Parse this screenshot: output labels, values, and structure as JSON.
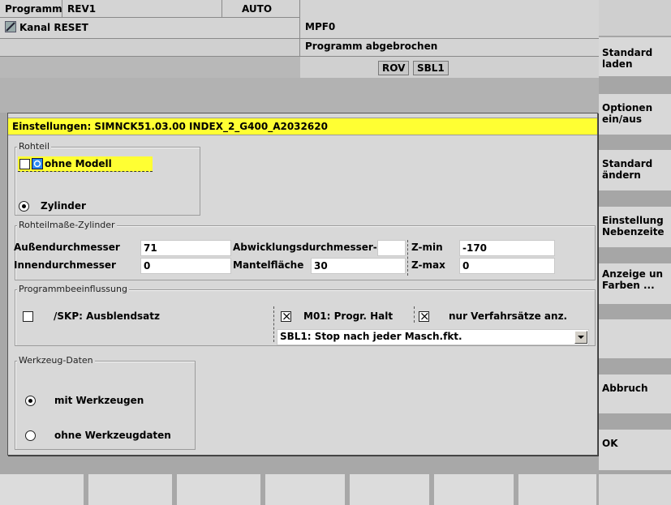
{
  "header": {
    "program_label": "Programm",
    "program_name": "REV1",
    "mode": "AUTO",
    "file": "MPF0",
    "channel_status": "Kanal RESET",
    "program_status": "Programm abgebrochen",
    "badges": [
      "ROV",
      "SBL1"
    ]
  },
  "softkeys_right": [
    "Standard\nladen",
    "Optionen\nein/aus",
    "Standard\nändern",
    "Einstellung\nNebenzeite",
    "Anzeige un\nFarben ...",
    "",
    "Abbruch",
    "OK"
  ],
  "dialog": {
    "title": "Einstellungen:  SIMNCK51.03.00   INDEX_2_G400_A2032620",
    "rohteil": {
      "legend": "Rohteil",
      "model_label": "ohne Modell",
      "model_checked": false,
      "zylinder_label": "Zylinder",
      "zylinder_selected": true
    },
    "masse": {
      "legend": "Rohteilmaße-Zylinder",
      "aussen_label": "Außendurchmesser",
      "aussen_value": "71",
      "innen_label": "Innendurchmesser",
      "innen_value": "0",
      "abwicklung_label": "Abwicklungsdurchmesser-",
      "abwicklung_value": "",
      "mantel_label": "Mantelfläche",
      "mantel_value": "30",
      "zmin_label": "Z-min",
      "zmin_value": "-170",
      "zmax_label": "Z-max",
      "zmax_value": "0"
    },
    "programm": {
      "legend": "Programmbeeinflussung",
      "skp_label": "/SKP: Ausblendsatz",
      "skp_checked": false,
      "m01_label": "M01: Progr. Halt",
      "m01_checked": true,
      "verfahr_label": "nur Verfahrsätze anz.",
      "verfahr_checked": true,
      "sbl_selected": "SBL1: Stop nach jeder Masch.fkt."
    },
    "werkzeug": {
      "legend": "Werkzeug-Daten",
      "mit_label": "mit Werkzeugen",
      "mit_selected": true,
      "ohne_label": "ohne Werkzeugdaten",
      "ohne_selected": false
    }
  }
}
